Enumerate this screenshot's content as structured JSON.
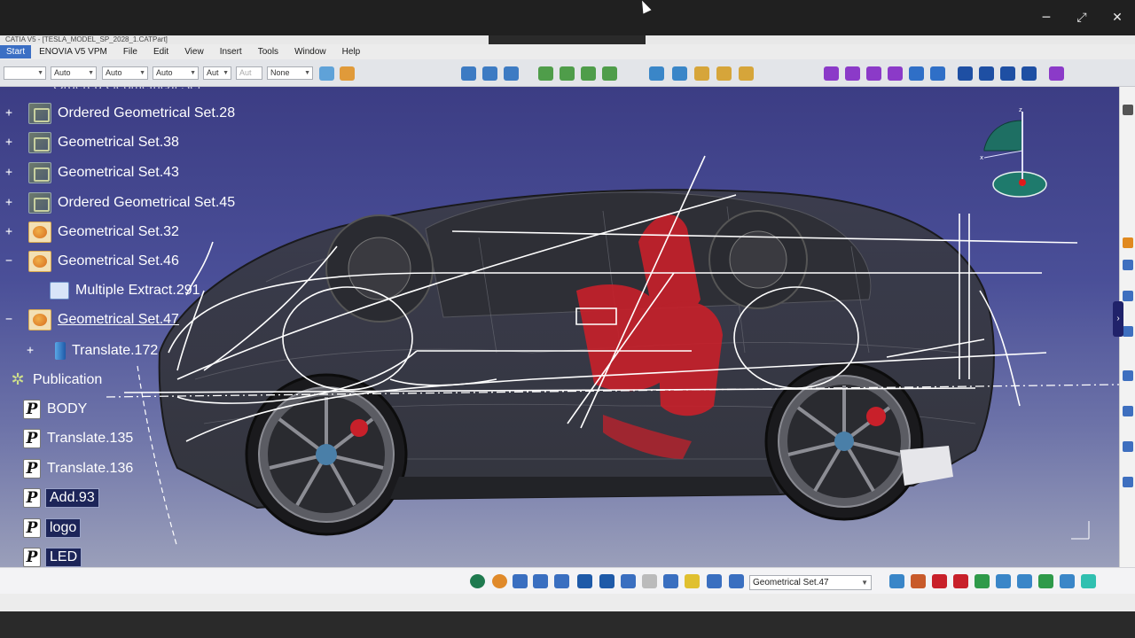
{
  "window": {
    "minimize": "─",
    "restore": "⤢",
    "close": "✕"
  },
  "app": {
    "title": "CATIA V5 - [TESLA_MODEL_SP_2028_1.CATPart]"
  },
  "menu": [
    "Start",
    "ENOVIA V5 VPM",
    "File",
    "Edit",
    "View",
    "Insert",
    "Tools",
    "Window",
    "Help"
  ],
  "toolbar": {
    "combos": [
      "",
      "Auto",
      "Auto",
      "Auto",
      "Aut",
      "Aut",
      "None"
    ]
  },
  "tree": {
    "items": [
      {
        "label": "Ordered Geometrical Set.28",
        "type": "geo"
      },
      {
        "label": "Geometrical Set.38",
        "type": "geo"
      },
      {
        "label": "Geometrical Set.43",
        "type": "geo"
      },
      {
        "label": "Ordered Geometrical Set.45",
        "type": "geo"
      },
      {
        "label": "Geometrical Set.32",
        "type": "set"
      },
      {
        "label": "Geometrical Set.46",
        "type": "set"
      },
      {
        "label": "Multiple Extract.291",
        "type": "ext"
      },
      {
        "label": "Geometrical Set.47",
        "type": "set"
      },
      {
        "label": "Translate.172",
        "type": "tr"
      },
      {
        "label": "Publication",
        "type": "pub-gear"
      },
      {
        "label": "BODY",
        "type": "pub"
      },
      {
        "label": "Translate.135",
        "type": "pub"
      },
      {
        "label": "Translate.136",
        "type": "pub"
      },
      {
        "label": "Add.93",
        "type": "pub"
      },
      {
        "label": "logo",
        "type": "pub"
      },
      {
        "label": "LED",
        "type": "pub"
      }
    ]
  },
  "bottom": {
    "current_set": "Geometrical Set.47"
  },
  "colors": {
    "viewport_top": "#3c3d84",
    "seat_red": "#c8202a",
    "wire_white": "#ffffff"
  }
}
